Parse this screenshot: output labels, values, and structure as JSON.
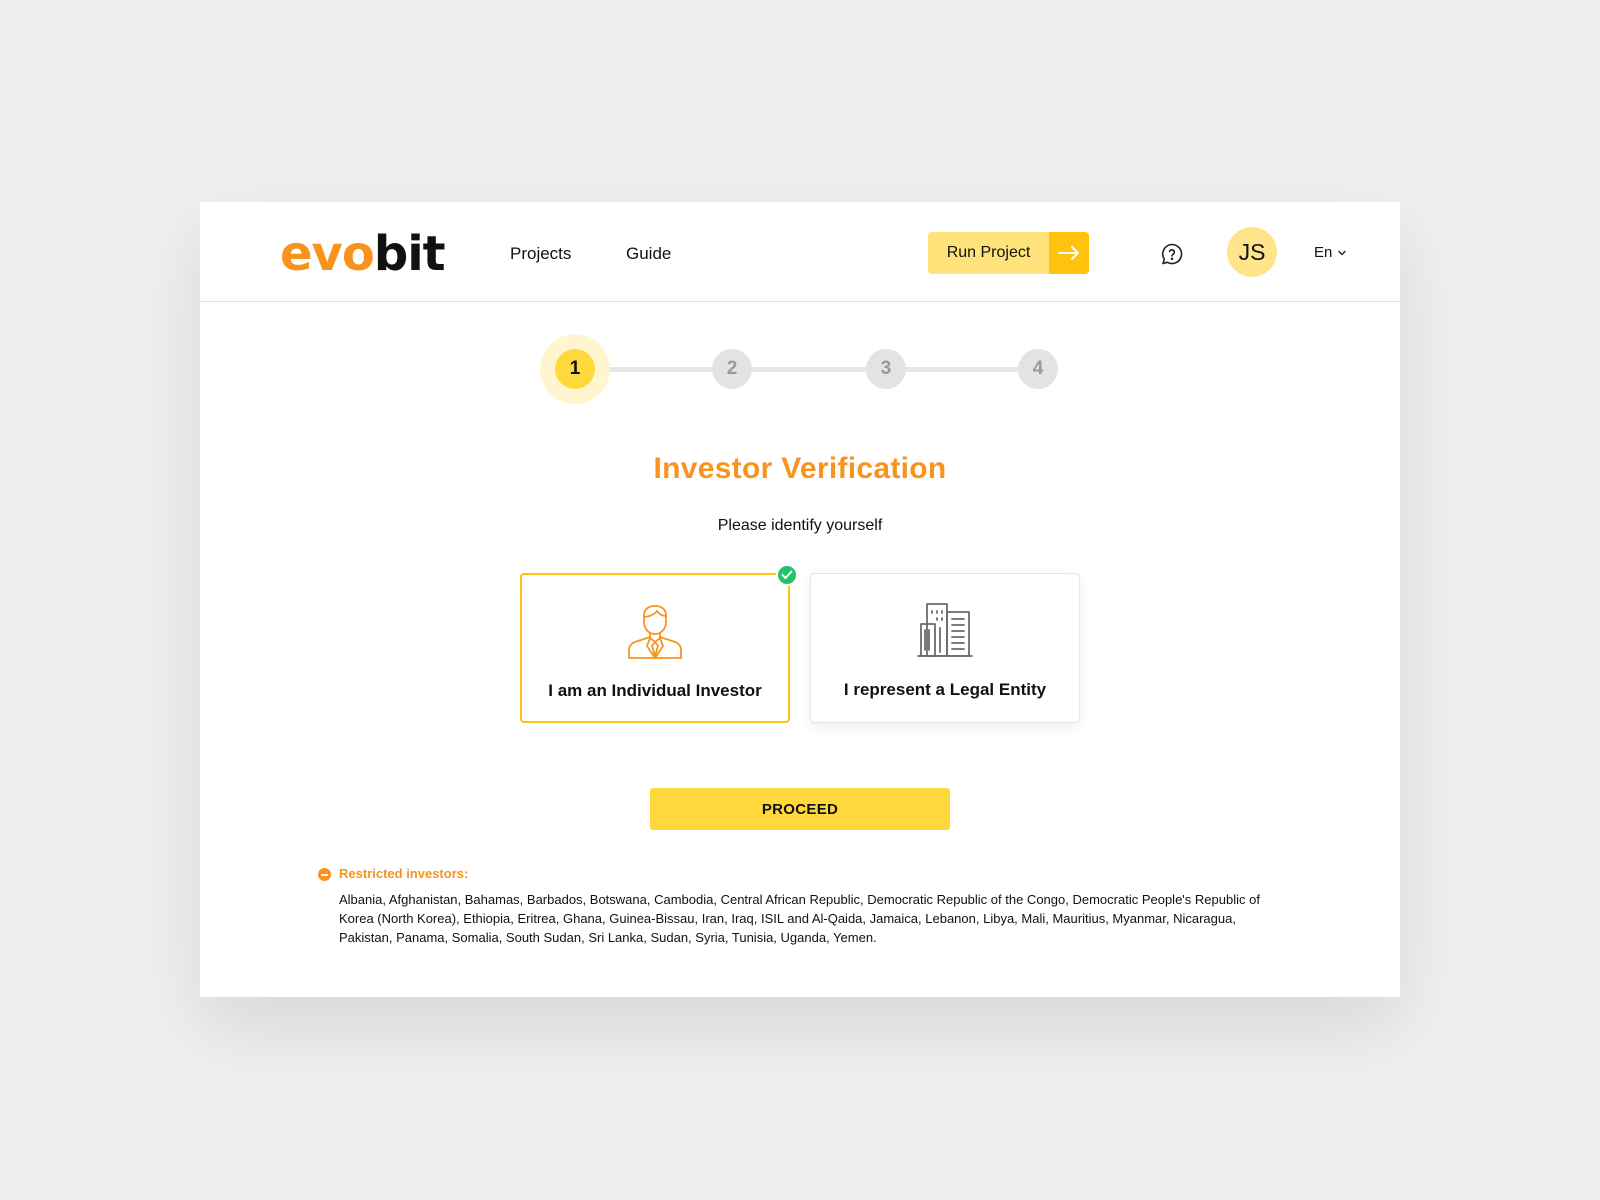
{
  "header": {
    "logo_part1": "evo",
    "logo_part2": "bit",
    "nav": [
      {
        "label": "Projects"
      },
      {
        "label": "Guide"
      }
    ],
    "run_project_label": "Run Project",
    "avatar_initials": "JS",
    "language": "En"
  },
  "stepper": {
    "steps": [
      "1",
      "2",
      "3",
      "4"
    ],
    "current_step": 1
  },
  "main": {
    "title": "Investor Verification",
    "subtitle": "Please identify yourself",
    "options": [
      {
        "label": "I am an Individual Investor",
        "icon": "person-icon",
        "selected": true
      },
      {
        "label": "I represent a Legal Entity",
        "icon": "building-icon",
        "selected": false
      }
    ],
    "proceed_label": "PROCEED"
  },
  "restricted": {
    "title": "Restricted investors:",
    "countries": "Albania, Afghanistan, Bahamas, Barbados, Botswana, Cambodia, Central African Republic, Democratic Republic of the Congo, Democratic People's Republic of Korea (North Korea), Ethiopia, Eritrea, Ghana, Guinea-Bissau, Iran, Iraq, ISIL and Al-Qaida, Jamaica, Lebanon, Libya, Mali, Mauritius, Myanmar, Nicaragua, Pakistan, Panama, Somalia, South Sudan, Sri Lanka, Sudan, Syria, Tunisia, Uganda, Yemen."
  },
  "colors": {
    "brand_orange": "#f7931e",
    "brand_yellow": "#ffd93b",
    "success_green": "#24c36a"
  }
}
